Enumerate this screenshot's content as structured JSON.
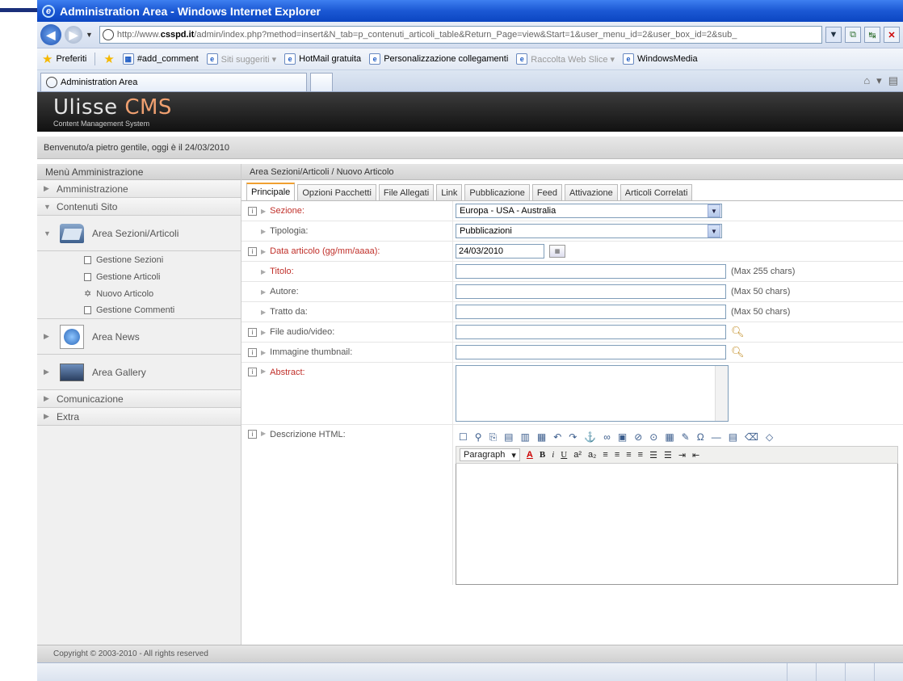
{
  "window": {
    "title": "Administration Area - Windows Internet Explorer"
  },
  "address": {
    "prefix": "http://www.",
    "domain": "csspd.it",
    "path": "/admin/index.php?method=insert&N_tab=p_contenuti_articoli_table&Return_Page=view&Start=1&user_menu_id=2&user_box_id=2&sub_"
  },
  "favorites": {
    "label": "Preferiti",
    "items": [
      "#add_comment",
      "Siti suggeriti ▾",
      "HotMail gratuita",
      "Personalizzazione collegamenti",
      "Raccolta Web Slice ▾",
      "WindowsMedia"
    ]
  },
  "browser_tab": {
    "label": "Administration Area"
  },
  "cms": {
    "logo": {
      "main": "Ulisse ",
      "accent": "CMS",
      "subtitle": "Content Management System"
    },
    "welcome": "Benvenuto/a pietro gentile, oggi è il 24/03/2010",
    "footer": "Copyright © 2003-2010 - All rights reserved"
  },
  "sidebar": {
    "header": "Menù Amministrazione",
    "items": {
      "amministrazione": "Amministrazione",
      "contenuti": "Contenuti Sito",
      "area_sezioni": "Area Sezioni/Articoli",
      "sub": [
        "Gestione Sezioni",
        "Gestione Articoli",
        "Nuovo Articolo",
        "Gestione Commenti"
      ],
      "area_news": "Area News",
      "area_gallery": "Area Gallery",
      "comunicazione": "Comunicazione",
      "extra": "Extra"
    }
  },
  "main": {
    "breadcrumb": "Area Sezioni/Articoli / Nuovo Articolo",
    "tabs": [
      "Principale",
      "Opzioni Pacchetti",
      "File Allegati",
      "Link",
      "Pubblicazione",
      "Feed",
      "Attivazione",
      "Articoli Correlati"
    ],
    "fields": {
      "sezione": {
        "label": "Sezione:",
        "value": "Europa - USA - Australia"
      },
      "tipologia": {
        "label": "Tipologia:",
        "value": "Pubblicazioni"
      },
      "data": {
        "label": "Data articolo (gg/mm/aaaa):",
        "value": "24/03/2010"
      },
      "titolo": {
        "label": "Titolo:",
        "hint": "(Max 255 chars)"
      },
      "autore": {
        "label": "Autore:",
        "hint": "(Max 50 chars)"
      },
      "tratto": {
        "label": "Tratto da:",
        "hint": "(Max 50 chars)"
      },
      "audio": {
        "label": "File audio/video:"
      },
      "thumb": {
        "label": "Immagine thumbnail:"
      },
      "abstract": {
        "label": "Abstract:"
      },
      "descrizione": {
        "label": "Descrizione HTML:",
        "format": "Paragraph"
      }
    }
  }
}
